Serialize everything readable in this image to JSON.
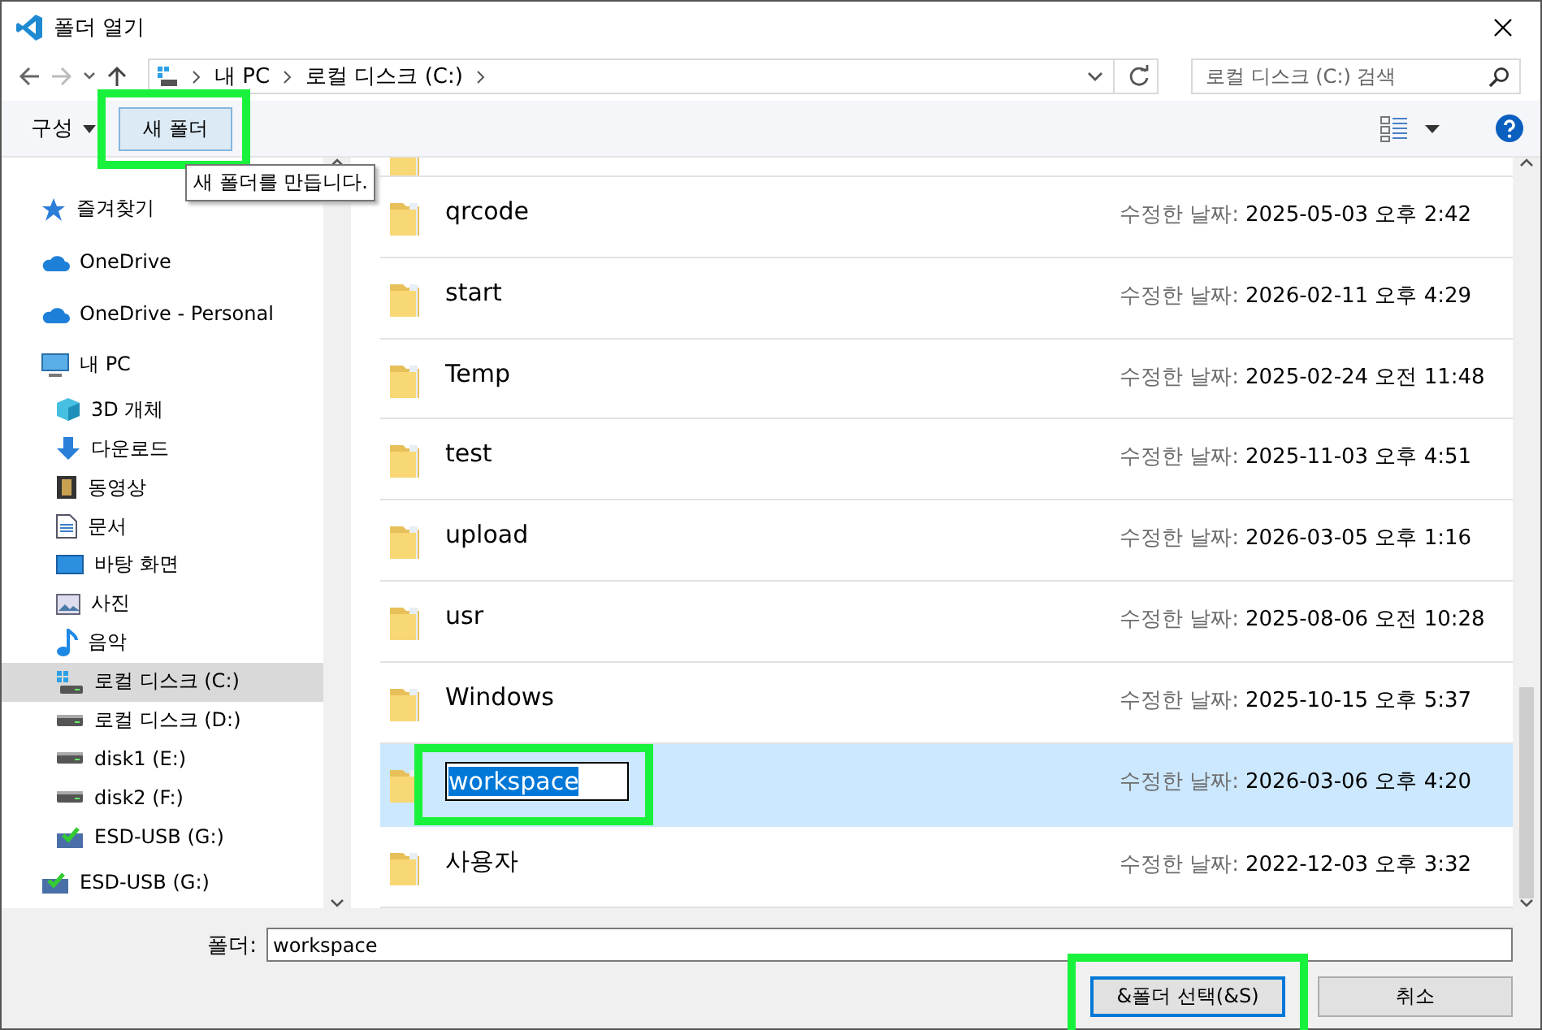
{
  "window": {
    "title": "폴더 열기"
  },
  "nav": {
    "breadcrumb": [
      "내 PC",
      "로컬 디스크 (C:)"
    ],
    "search": {
      "placeholder": "로컬 디스크 (C:) 검색"
    }
  },
  "toolbar": {
    "organize": "구성",
    "new_folder": {
      "label": "새 폴더",
      "highlighted": true
    },
    "tooltip": "새 폴더를 만듭니다."
  },
  "sidebar": {
    "items": [
      {
        "label": "즐겨찾기",
        "kind": "star",
        "selected": false
      },
      {
        "label": "OneDrive",
        "kind": "cloud",
        "selected": false
      },
      {
        "label": "OneDrive - Personal",
        "kind": "cloud",
        "selected": false
      },
      {
        "label": "내 PC",
        "kind": "pc",
        "selected": false,
        "children": [
          {
            "label": "3D 개체",
            "kind": "cube",
            "selected": false
          },
          {
            "label": "다운로드",
            "kind": "download",
            "selected": false
          },
          {
            "label": "동영상",
            "kind": "film",
            "selected": false
          },
          {
            "label": "문서",
            "kind": "doc",
            "selected": false
          },
          {
            "label": "바탕 화면",
            "kind": "desktop",
            "selected": false
          },
          {
            "label": "사진",
            "kind": "picture",
            "selected": false
          },
          {
            "label": "음악",
            "kind": "music",
            "selected": false
          },
          {
            "label": "로컬 디스크 (C:)",
            "kind": "windrive",
            "selected": true
          },
          {
            "label": "로컬 디스크 (D:)",
            "kind": "drive",
            "selected": false
          },
          {
            "label": "disk1 (E:)",
            "kind": "drive",
            "selected": false
          },
          {
            "label": "disk2 (F:)",
            "kind": "drive",
            "selected": false
          },
          {
            "label": "ESD-USB (G:)",
            "kind": "usb",
            "selected": false
          }
        ]
      },
      {
        "label": "ESD-USB (G:)",
        "kind": "usb",
        "selected": false
      }
    ]
  },
  "files": {
    "rows": [
      {
        "kind": "partial",
        "selected": false
      },
      {
        "kind": "folder",
        "name": "qrcode",
        "date_label": "수정한 날짜:",
        "date": "2025-05-03 오후 2:42",
        "selected": false,
        "renaming": false
      },
      {
        "kind": "folder",
        "name": "start",
        "date_label": "수정한 날짜:",
        "date": "2026-02-11 오후 4:29",
        "selected": false,
        "renaming": false
      },
      {
        "kind": "folder",
        "name": "Temp",
        "date_label": "수정한 날짜:",
        "date": "2025-02-24 오전 11:48",
        "selected": false,
        "renaming": false
      },
      {
        "kind": "folder",
        "name": "test",
        "date_label": "수정한 날짜:",
        "date": "2025-11-03 오후 4:51",
        "selected": false,
        "renaming": false
      },
      {
        "kind": "folder",
        "name": "upload",
        "date_label": "수정한 날짜:",
        "date": "2026-03-05 오후 1:16",
        "selected": false,
        "renaming": false
      },
      {
        "kind": "folder",
        "name": "usr",
        "date_label": "수정한 날짜:",
        "date": "2025-08-06 오전 10:28",
        "selected": false,
        "renaming": false
      },
      {
        "kind": "folder",
        "name": "Windows",
        "date_label": "수정한 날짜:",
        "date": "2025-10-15 오후 5:37",
        "selected": false,
        "renaming": false
      },
      {
        "kind": "folder",
        "name": "workspace",
        "date_label": "수정한 날짜:",
        "date": "2026-03-06 오후 4:20",
        "selected": true,
        "renaming": true,
        "highlighted": true
      },
      {
        "kind": "folder",
        "name": "사용자",
        "date_label": "수정한 날짜:",
        "date": "2022-12-03 오후 3:32",
        "selected": false,
        "renaming": false
      }
    ]
  },
  "footer": {
    "folder_label": "폴더:",
    "folder_value": "workspace",
    "buttons": [
      {
        "label": "&폴더 선택(&S)",
        "default": true,
        "highlighted": true
      },
      {
        "label": "취소",
        "default": false,
        "highlighted": false
      }
    ]
  }
}
